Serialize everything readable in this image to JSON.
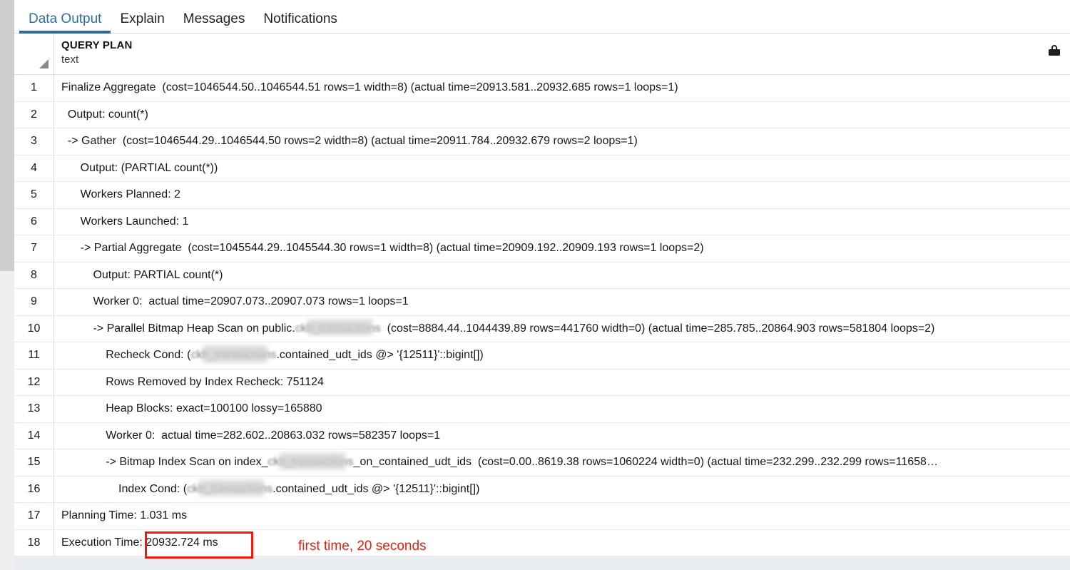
{
  "tabs": [
    {
      "label": "Data Output",
      "active": true
    },
    {
      "label": "Explain",
      "active": false
    },
    {
      "label": "Messages",
      "active": false
    },
    {
      "label": "Notifications",
      "active": false
    }
  ],
  "grid": {
    "column": {
      "name": "QUERY PLAN",
      "type": "text",
      "lock_icon": "lock-icon"
    },
    "corner_icon": "select-all-triangle-icon",
    "rows": [
      {
        "num": "1",
        "text": "Finalize Aggregate  (cost=1046544.50..1046544.51 rows=1 width=8) (actual time=20913.581..20932.685 rows=1 loops=1)"
      },
      {
        "num": "2",
        "text": "  Output: count(*)"
      },
      {
        "num": "3",
        "text": "  -> Gather  (cost=1046544.29..1046544.50 rows=2 width=8) (actual time=20911.784..20932.679 rows=2 loops=1)"
      },
      {
        "num": "4",
        "text": "      Output: (PARTIAL count(*))"
      },
      {
        "num": "5",
        "text": "      Workers Planned: 2"
      },
      {
        "num": "6",
        "text": "      Workers Launched: 1"
      },
      {
        "num": "7",
        "text": "      -> Partial Aggregate  (cost=1045544.29..1045544.30 rows=1 width=8) (actual time=20909.192..20909.193 rows=1 loops=2)"
      },
      {
        "num": "8",
        "text": "          Output: PARTIAL count(*)"
      },
      {
        "num": "9",
        "text": "          Worker 0:  actual time=20907.073..20907.073 rows=1 loops=1"
      },
      {
        "num": "10",
        "prefix": "          -> Parallel Bitmap Heap Scan on public.",
        "redacted": "ckb_transactions",
        "suffix": "  (cost=8884.44..1044439.89 rows=441760 width=0) (actual time=285.785..20864.903 rows=581804 loops=2)"
      },
      {
        "num": "11",
        "prefix": "              Recheck Cond: (",
        "redacted": "ckb_transactions",
        "suffix": ".contained_udt_ids @> '{12511}'::bigint[])"
      },
      {
        "num": "12",
        "text": "              Rows Removed by Index Recheck: 751124"
      },
      {
        "num": "13",
        "text": "              Heap Blocks: exact=100100 lossy=165880"
      },
      {
        "num": "14",
        "text": "              Worker 0:  actual time=282.602..20863.032 rows=582357 loops=1"
      },
      {
        "num": "15",
        "prefix": "              -> Bitmap Index Scan on index_",
        "redacted": "ckb_transactions",
        "suffix": "_on_contained_udt_ids  (cost=0.00..8619.38 rows=1060224 width=0) (actual time=232.299..232.299 rows=11658…"
      },
      {
        "num": "16",
        "prefix": "                  Index Cond: (",
        "redacted": "ckb_transactions",
        "suffix": ".contained_udt_ids @> '{12511}'::bigint[])"
      },
      {
        "num": "17",
        "text": "Planning Time: 1.031 ms"
      },
      {
        "num": "18",
        "text": "Execution Time: 20932.724 ms"
      }
    ]
  },
  "annotation": {
    "highlight_target": "20932.724 ms",
    "note": "first time, 20 seconds",
    "color": "#ef1b0c"
  },
  "scrollbar": {
    "orientation": "vertical",
    "position": "left"
  }
}
